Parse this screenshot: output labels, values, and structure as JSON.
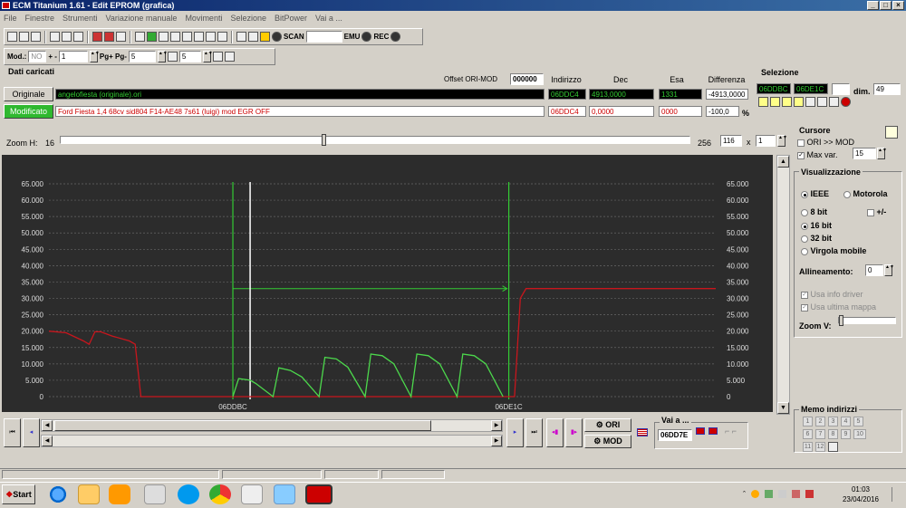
{
  "window": {
    "title": "ECM Titanium 1.61 - Edit EPROM (grafica)",
    "min": "_",
    "max": "×",
    "close": "×",
    "restore": "□"
  },
  "menu": [
    "File",
    "Finestre",
    "Strumenti",
    "Variazione manuale",
    "Movimenti",
    "Selezione",
    "BitPower",
    "Vai a ..."
  ],
  "toolbar1": {
    "scan": "SCAN",
    "emu": "EMU",
    "rec": "REC"
  },
  "toolbar2": {
    "mod_label": "Mod.:",
    "mod_value": "NO",
    "plusminus": "+ -",
    "step": "1",
    "pg": "Pg+ Pg-",
    "pg_value": "5",
    "val3": "5"
  },
  "dati": {
    "title": "Dati caricati",
    "offset_label": "Offset ORI-MOD",
    "offset_value": "000000",
    "col_indirizzo": "Indirizzo",
    "col_dec": "Dec",
    "col_esa": "Esa",
    "col_diff": "Differenza",
    "ori_btn": "Originale",
    "ori_file": "angelofiesta (originale).ori",
    "ori_addr": "06DDC4",
    "ori_dec": "4913,0000",
    "ori_esa": "1331",
    "ori_diff": "-4913,0000",
    "mod_btn": "Modificato",
    "mod_file": "Ford Fiesta 1,4 68cv sid804 F14-AE48 7s61 (luigi) mod EGR OFF",
    "mod_addr": "06DDC4",
    "mod_dec": "0,0000",
    "mod_esa": "0000",
    "mod_diff": "-100,0",
    "pct": "%"
  },
  "selezione": {
    "title": "Selezione",
    "start": "06DDBC",
    "end": "06DE1C",
    "dim_label": "dim.",
    "dim_value": "49"
  },
  "zoom": {
    "label": "Zoom H:",
    "min": "16",
    "max": "256",
    "value": "116",
    "x": "x",
    "mult": "1"
  },
  "chart_data": {
    "type": "line",
    "y_ticks": [
      "65.000",
      "60.000",
      "55.000",
      "50.000",
      "45.000",
      "40.000",
      "35.000",
      "30.000",
      "25.000",
      "20.000",
      "15.000",
      "10.000",
      "5.000",
      "0"
    ],
    "ylim": [
      0,
      65000
    ],
    "xlim": [
      0,
      116
    ],
    "x_markers": [
      {
        "label": "06DDBC",
        "x": 32
      },
      {
        "label": "06DE1C",
        "x": 80
      }
    ],
    "cursor_x": 35,
    "grid": true,
    "series": [
      {
        "color": "#c8161d",
        "points": [
          [
            0,
            20000
          ],
          [
            3,
            19500
          ],
          [
            6,
            17000
          ],
          [
            7,
            16000
          ],
          [
            8,
            19800
          ],
          [
            9,
            19800
          ],
          [
            11,
            18500
          ],
          [
            14,
            17000
          ],
          [
            15,
            16000
          ],
          [
            16,
            0
          ],
          [
            81,
            0
          ],
          [
            82,
            30000
          ],
          [
            83,
            33000
          ],
          [
            116,
            33000
          ]
        ]
      },
      {
        "color": "#4cd84c",
        "points": [
          [
            32,
            0
          ],
          [
            33,
            5500
          ],
          [
            35,
            5000
          ],
          [
            36,
            4000
          ],
          [
            39,
            0
          ],
          [
            40,
            8800
          ],
          [
            42,
            8000
          ],
          [
            44,
            6000
          ],
          [
            47,
            0
          ],
          [
            48,
            12000
          ],
          [
            50,
            11500
          ],
          [
            52,
            9000
          ],
          [
            55,
            0
          ],
          [
            56,
            13000
          ],
          [
            58,
            12500
          ],
          [
            60,
            10000
          ],
          [
            63,
            0
          ],
          [
            64,
            13000
          ],
          [
            66,
            12500
          ],
          [
            68,
            10000
          ],
          [
            71,
            0
          ],
          [
            72,
            13000
          ],
          [
            74,
            12500
          ],
          [
            76,
            10000
          ],
          [
            79,
            0
          ]
        ]
      }
    ]
  },
  "cursore": {
    "title": "Cursore",
    "ori_mod": "ORI >> MOD",
    "maxvar": "Max var.",
    "maxvar_value": "15"
  },
  "visualizzazione": {
    "title": "Visualizzazione",
    "ieee": "IEEE",
    "motorola": "Motorola",
    "b8": "8 bit",
    "pm": "+/-",
    "b16": "16 bit",
    "b32": "32 bit",
    "vm": "Virgola mobile",
    "allineamento": "Allineamento:",
    "allineamento_value": "0",
    "usa_info": "Usa info driver",
    "usa_mappa": "Usa ultima mappa",
    "zoomv": "Zoom V:"
  },
  "bottom": {
    "ori": "ORI",
    "mod": "MOD",
    "vai_label": "Vai a ...",
    "vai_value": "06DD7E"
  },
  "memo": {
    "title": "Memo indirizzi",
    "keys": [
      "1",
      "2",
      "3",
      "4",
      "5",
      "6",
      "7",
      "8",
      "9",
      "10",
      "11",
      "12"
    ]
  },
  "taskbar": {
    "start": "Start",
    "time": "01:03",
    "date": "23/04/2016"
  },
  "colors": {
    "ori_green": "#33cc33",
    "mod_red": "#cc0000",
    "chart_bg": "#2c2c2c"
  }
}
